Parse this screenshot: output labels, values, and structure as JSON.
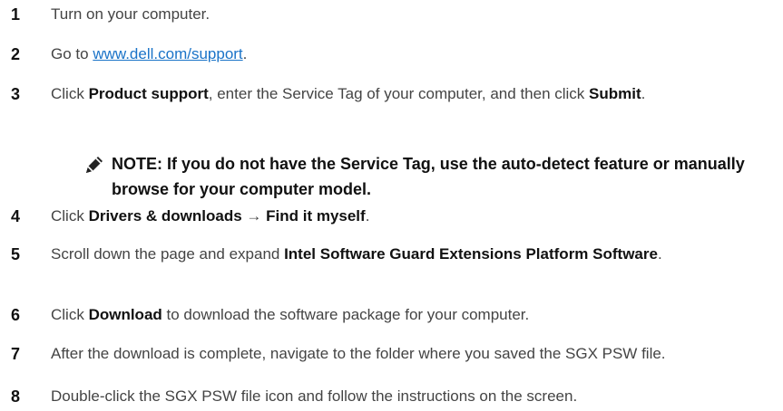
{
  "steps": [
    {
      "num": "1",
      "text": "Turn on your computer."
    },
    {
      "num": "2",
      "pre": "Go to ",
      "link": "www.dell.com/support",
      "post": "."
    },
    {
      "num": "3",
      "t1": "Click ",
      "b1": "Product support",
      "t2": ", enter the Service Tag of your computer, and then click ",
      "b2": "Submit",
      "t3": "."
    },
    {
      "num": "4",
      "t1": "Click ",
      "b1": "Drivers & downloads",
      "t2": " → ",
      "b2": "Find it myself",
      "t3": "."
    },
    {
      "num": "5",
      "t1": "Scroll down the page and expand ",
      "b1": "Intel Software Guard Extensions Platform Software",
      "t2": "."
    },
    {
      "num": "6",
      "t1": "Click ",
      "b1": "Download",
      "t2": " to download the software package for your computer."
    },
    {
      "num": "7",
      "text": "After the download is complete, navigate to the folder where you saved the SGX PSW file."
    },
    {
      "num": "8",
      "text": "Double-click the SGX PSW file icon and follow the instructions on the screen."
    }
  ],
  "note": {
    "icon": "pencil-icon",
    "text": "NOTE: If you do not have the Service Tag, use the auto-detect feature or manually browse for your computer model."
  }
}
